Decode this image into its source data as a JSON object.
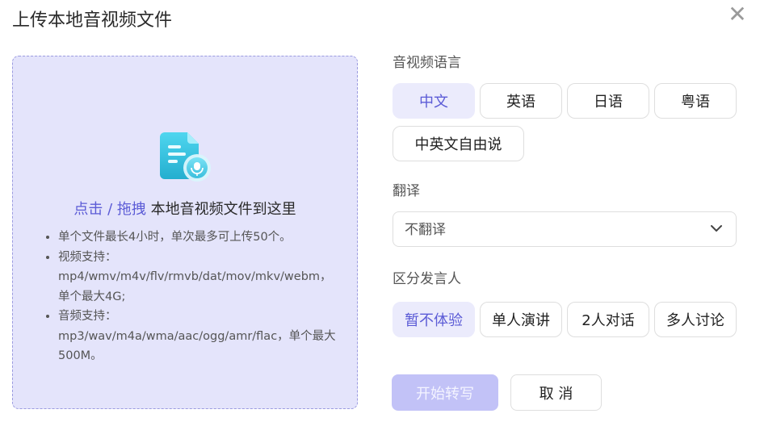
{
  "dialog": {
    "title": "上传本地音视频文件",
    "close_icon": "close-icon"
  },
  "upload": {
    "icon": "audio-video-file-icon",
    "link_text": "点击 / 拖拽",
    "rest_text": " 本地音视频文件到这里",
    "rules": [
      "单个文件最长4小时，单次最多可上传50个。",
      "视频支持：mp4/wmv/m4v/flv/rmvb/dat/mov/mkv/webm，单个最大4G;",
      "音频支持：mp3/wav/m4a/wma/aac/ogg/amr/flac，单个最大500M。"
    ]
  },
  "language": {
    "label": "音视频语言",
    "options": [
      "中文",
      "英语",
      "日语",
      "粤语",
      "中英文自由说"
    ],
    "selected": "中文"
  },
  "translate": {
    "label": "翻译",
    "value": "不翻译",
    "chevron_icon": "chevron-down-icon"
  },
  "speaker": {
    "label": "区分发言人",
    "options": [
      "暂不体验",
      "单人演讲",
      "2人对话",
      "多人讨论"
    ],
    "selected": "暂不体验"
  },
  "actions": {
    "start_label": "开始转写",
    "cancel_label": "取 消"
  },
  "colors": {
    "accent": "#5b5bd6",
    "dropzone_bg": "#e4e4fb",
    "active_option_bg": "#ebebfc",
    "disabled_button_bg": "#c2c2f7"
  }
}
